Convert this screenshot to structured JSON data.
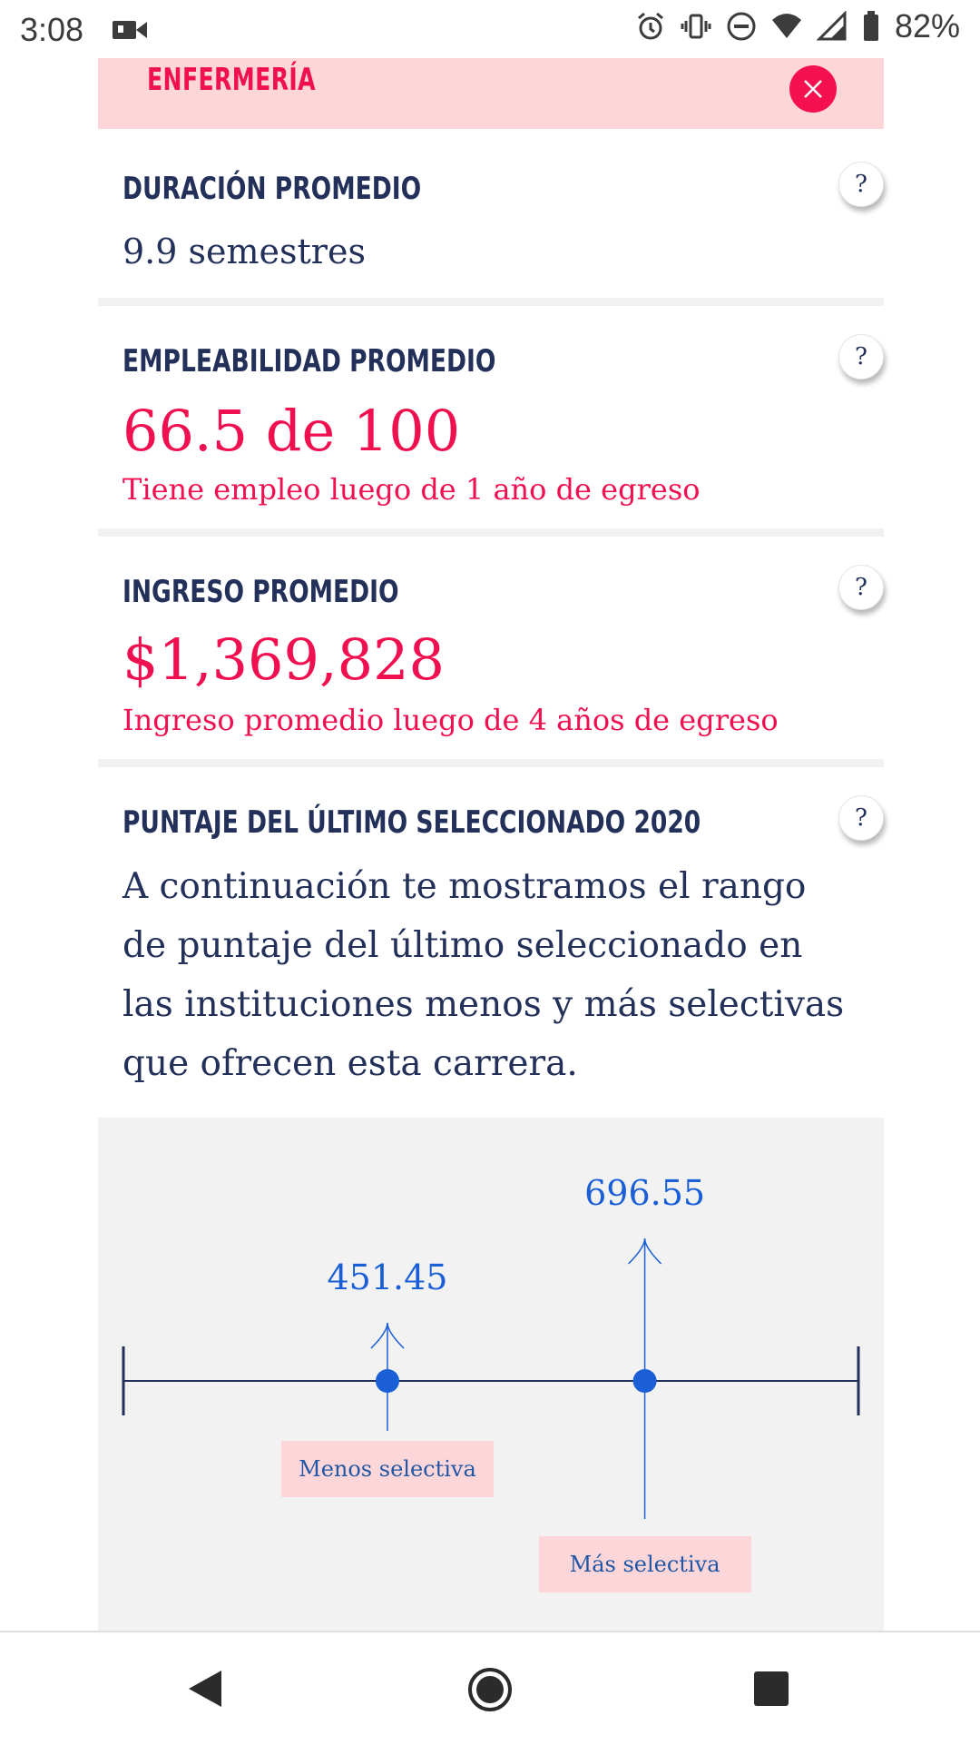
{
  "status_bar": {
    "time": "3:08",
    "battery": "82%",
    "icons": [
      "video-camera-icon",
      "alarm-icon",
      "vibrate-icon",
      "do-not-disturb-icon",
      "wifi-icon",
      "signal-icon",
      "battery-icon"
    ]
  },
  "header": {
    "title": "ENFERMERÍA",
    "close_icon": "close-icon"
  },
  "duracion": {
    "title": "DURACIÓN PROMEDIO",
    "value": "9.9 semestres",
    "help": "?"
  },
  "empleabilidad": {
    "title": "EMPLEABILIDAD PROMEDIO",
    "value": "66.5 de 100",
    "note": "Tiene empleo luego de 1 año de egreso",
    "help": "?"
  },
  "ingreso": {
    "title": "INGRESO PROMEDIO",
    "value": "$1,369,828",
    "note": "Ingreso promedio luego de 4 años de egreso",
    "help": "?"
  },
  "puntaje": {
    "title": "PUNTAJE DEL ÚLTIMO SELECCIONADO 2020",
    "help": "?",
    "description": "A continuación te mostramos el rango de puntaje del último seleccionado en las instituciones menos y más selectivas que ofrecen esta carrera."
  },
  "chart_data": {
    "type": "scatter",
    "points": [
      {
        "label": "Menos selectiva",
        "value": 451.45,
        "value_text": "451.45"
      },
      {
        "label": "Más selectiva",
        "value": 696.55,
        "value_text": "696.55"
      }
    ],
    "colors": {
      "point": "#1a5fd6",
      "axis": "#23305a",
      "label_bg": "#fcd6d9"
    }
  },
  "nav_bar": {
    "icons": [
      "back-icon",
      "home-icon",
      "recents-icon"
    ]
  },
  "colors": {
    "accent": "#f0104f",
    "navy": "#23305a",
    "pink_bg": "#fcd6d9"
  }
}
